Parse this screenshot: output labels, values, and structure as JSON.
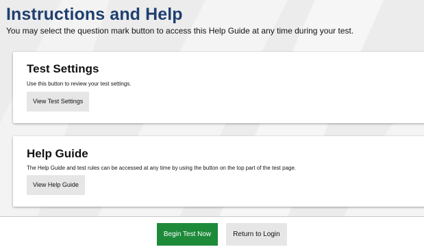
{
  "header": {
    "title": "Instructions and Help",
    "subtitle": "You may select the question mark button to access this Help Guide at any time during your test."
  },
  "sections": [
    {
      "title": "Test Settings",
      "description": "Use this button to review your test settings.",
      "button_label": "View Test Settings"
    },
    {
      "title": "Help Guide",
      "description": "The Help Guide and test rules can be accessed at any time by using the button on the top part of the test page.",
      "button_label": "View Help Guide"
    }
  ],
  "footer": {
    "begin_label": "Begin Test Now",
    "return_label": "Return to Login"
  },
  "colors": {
    "title": "#1f3f6f",
    "begin_button": "#1d8a3a",
    "secondary_button": "#e6e6e6",
    "background": "#ededed",
    "card": "#ffffff"
  }
}
